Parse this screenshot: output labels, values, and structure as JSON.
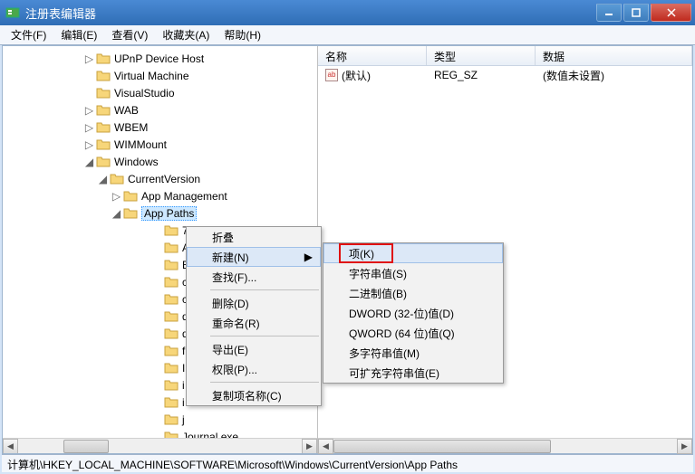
{
  "title": "注册表编辑器",
  "menus": {
    "file": "文件(F)",
    "edit": "编辑(E)",
    "view": "查看(V)",
    "favorites": "收藏夹(A)",
    "help": "帮助(H)"
  },
  "tree": {
    "items": [
      {
        "indent": 88,
        "toggle": "▷",
        "label": "UPnP Device Host"
      },
      {
        "indent": 88,
        "toggle": "",
        "label": "Virtual Machine"
      },
      {
        "indent": 88,
        "toggle": "",
        "label": "VisualStudio"
      },
      {
        "indent": 88,
        "toggle": "▷",
        "label": "WAB"
      },
      {
        "indent": 88,
        "toggle": "▷",
        "label": "WBEM"
      },
      {
        "indent": 88,
        "toggle": "▷",
        "label": "WIMMount"
      },
      {
        "indent": 88,
        "toggle": "◢",
        "label": "Windows"
      },
      {
        "indent": 103,
        "toggle": "◢",
        "label": "CurrentVersion"
      },
      {
        "indent": 118,
        "toggle": "▷",
        "label": "App Management"
      },
      {
        "indent": 118,
        "toggle": "◢",
        "label": "App Paths",
        "selected": true
      },
      {
        "indent": 163,
        "toggle": "",
        "label": "7"
      },
      {
        "indent": 163,
        "toggle": "",
        "label": "A"
      },
      {
        "indent": 163,
        "toggle": "",
        "label": "B"
      },
      {
        "indent": 163,
        "toggle": "",
        "label": "c"
      },
      {
        "indent": 163,
        "toggle": "",
        "label": "c"
      },
      {
        "indent": 163,
        "toggle": "",
        "label": "d"
      },
      {
        "indent": 163,
        "toggle": "",
        "label": "d"
      },
      {
        "indent": 163,
        "toggle": "",
        "label": "f"
      },
      {
        "indent": 163,
        "toggle": "",
        "label": "I"
      },
      {
        "indent": 163,
        "toggle": "",
        "label": "i"
      },
      {
        "indent": 163,
        "toggle": "",
        "label": "i"
      },
      {
        "indent": 163,
        "toggle": "",
        "label": "j"
      },
      {
        "indent": 163,
        "toggle": "",
        "label": "Journal.exe"
      }
    ]
  },
  "columns": {
    "name": "名称",
    "type": "类型",
    "data": "数据"
  },
  "rows": [
    {
      "name": "(默认)",
      "type": "REG_SZ",
      "data": "(数值未设置)"
    }
  ],
  "ctx1": {
    "collapse": "折叠",
    "new": "新建(N)",
    "find": "查找(F)...",
    "delete": "删除(D)",
    "rename": "重命名(R)",
    "export": "导出(E)",
    "perm": "权限(P)...",
    "copykey": "复制项名称(C)"
  },
  "ctx2": {
    "key": "项(K)",
    "string": "字符串值(S)",
    "binary": "二进制值(B)",
    "dword": "DWORD (32-位)值(D)",
    "qword": "QWORD (64 位)值(Q)",
    "multi": "多字符串值(M)",
    "expand": "可扩充字符串值(E)"
  },
  "status": "计算机\\HKEY_LOCAL_MACHINE\\SOFTWARE\\Microsoft\\Windows\\CurrentVersion\\App Paths"
}
